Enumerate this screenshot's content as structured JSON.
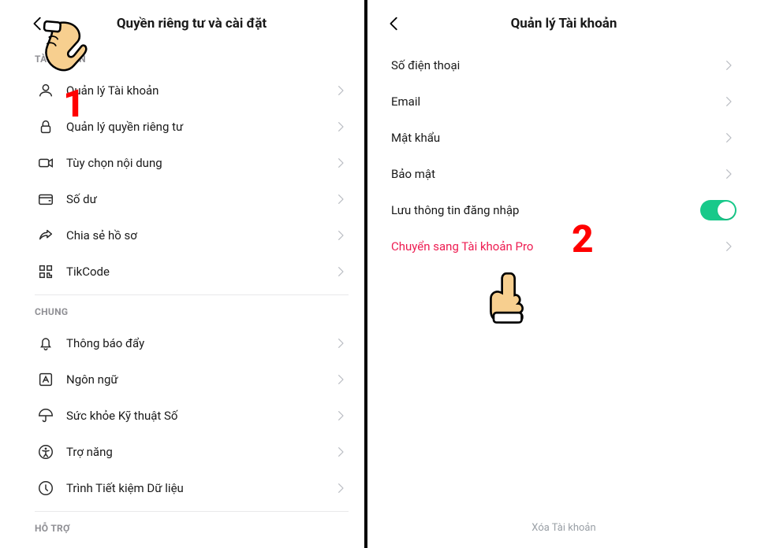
{
  "left": {
    "title": "Quyền riêng tư và cài đặt",
    "sections": {
      "account": {
        "header": "TÀI KHOẢN",
        "items": [
          {
            "label": "Quản lý Tài khoản"
          },
          {
            "label": "Quản lý quyền riêng tư"
          },
          {
            "label": "Tùy chọn nội dung"
          },
          {
            "label": "Số dư"
          },
          {
            "label": "Chia sẻ hồ sơ"
          },
          {
            "label": "TikCode"
          }
        ]
      },
      "general": {
        "header": "CHUNG",
        "items": [
          {
            "label": "Thông báo đẩy"
          },
          {
            "label": "Ngôn ngữ"
          },
          {
            "label": "Sức khỏe Kỹ thuật Số"
          },
          {
            "label": "Trợ năng"
          },
          {
            "label": "Trình Tiết kiệm Dữ liệu"
          }
        ]
      },
      "support": {
        "header": "HỖ TRỢ"
      }
    }
  },
  "right": {
    "title": "Quản lý Tài khoản",
    "items": {
      "phone": {
        "label": "Số điện thoại"
      },
      "email": {
        "label": "Email"
      },
      "password": {
        "label": "Mật khẩu"
      },
      "security": {
        "label": "Bảo mật"
      },
      "saveLogin": {
        "label": "Lưu thông tin đăng nhập",
        "on": true
      },
      "pro": {
        "label": "Chuyển sang Tài khoản Pro"
      }
    },
    "delete": "Xóa Tài khoản"
  },
  "steps": {
    "s1": "1",
    "s2": "2"
  }
}
